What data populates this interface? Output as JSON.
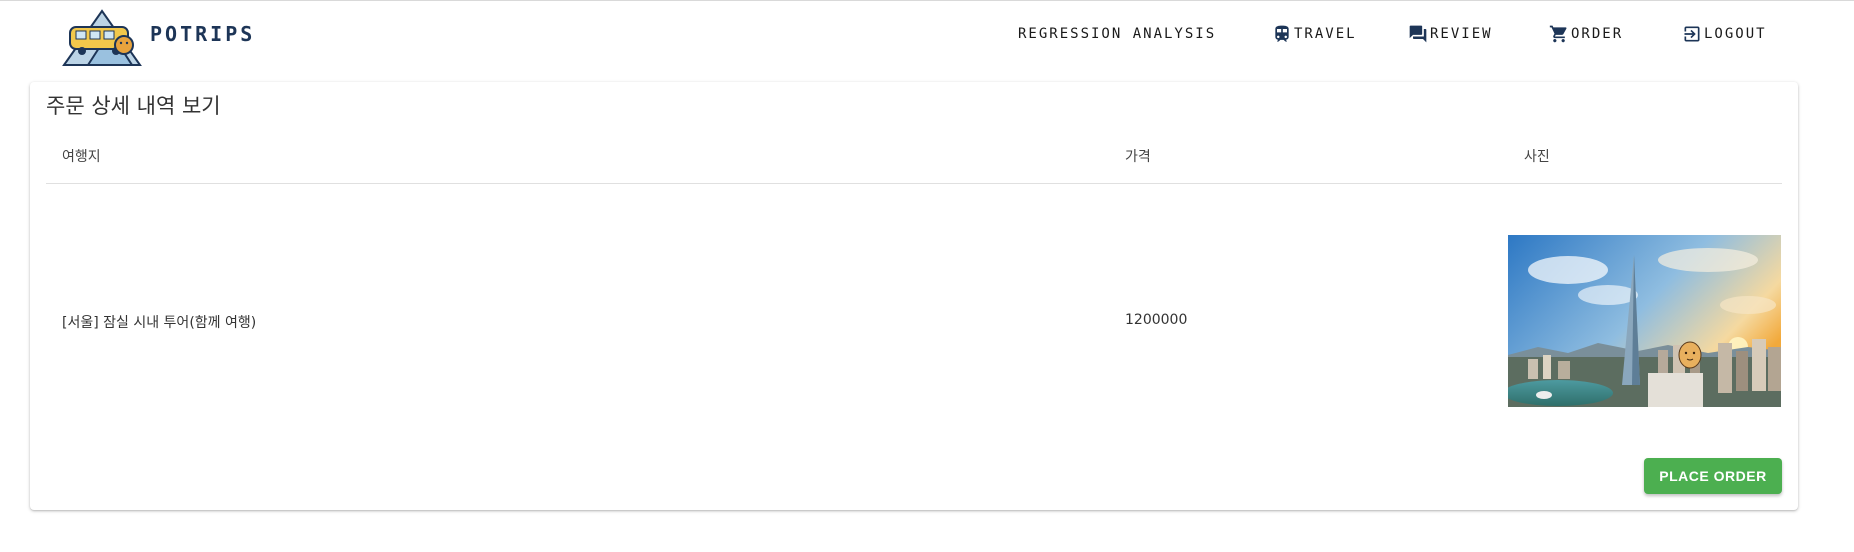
{
  "header": {
    "brand": "POTRIPS",
    "nav": {
      "regression": "REGRESSION ANALYSIS",
      "travel": "TRAVEL",
      "review": "REVIEW",
      "order": "ORDER",
      "logout": "LOGOUT"
    }
  },
  "order_detail": {
    "title": "주문 상세 내역 보기",
    "columns": {
      "destination": "여행지",
      "price": "가격",
      "photo": "사진"
    },
    "row": {
      "destination": "[서울] 잠실 시내 투어(함께 여행)",
      "price": "1200000"
    },
    "place_order_label": "PLACE ORDER"
  },
  "colors": {
    "accent": "#4caf50",
    "brand": "#1d3557"
  }
}
